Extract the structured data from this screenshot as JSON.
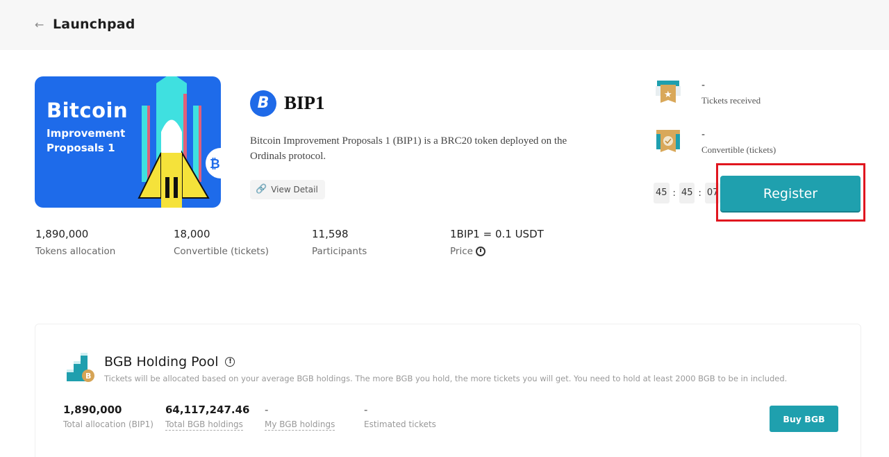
{
  "header": {
    "title": "Launchpad",
    "back_icon": "arrow-left-icon"
  },
  "banner": {
    "title": "Bitcoin",
    "subtitle_line1": "Improvement",
    "subtitle_line2": "Proposals 1",
    "colors": {
      "background": "#1e6bea"
    }
  },
  "token": {
    "logo_glyph": "B",
    "name": "BIP1",
    "description": "Bitcoin Improvement Proposals 1 (BIP1) is a BRC20 token deployed on the Ordinals protocol.",
    "view_detail_label": "View Detail"
  },
  "stats": [
    {
      "value": "1,890,000",
      "label": "Tokens allocation"
    },
    {
      "value": "18,000",
      "label": "Convertible (tickets)"
    },
    {
      "value": "11,598",
      "label": "Participants"
    },
    {
      "value": "1BIP1 = 0.1 USDT",
      "label": "Price"
    }
  ],
  "tickets": {
    "received": {
      "value": "-",
      "label": "Tickets received",
      "icon": "ticket-star-icon"
    },
    "convertible": {
      "value": "-",
      "label": "Convertible (tickets)",
      "icon": "ticket-check-icon"
    }
  },
  "countdown": {
    "hours": "45",
    "minutes": "45",
    "seconds": "07",
    "separator": ":"
  },
  "register": {
    "label": "Register",
    "accent": "#1fa0ae",
    "highlight": "#e0161f"
  },
  "pool": {
    "title": "BGB Holding Pool",
    "description": "Tickets will be allocated based on your average BGB holdings. The more BGB you hold, the more tickets you will get. You need to hold at least 2000 BGB to be in included.",
    "stats": [
      {
        "value": "1,890,000",
        "label": "Total allocation (BIP1)"
      },
      {
        "value": "64,117,247.46",
        "label": "Total BGB holdings"
      },
      {
        "value": "-",
        "label": "My BGB holdings"
      },
      {
        "value": "-",
        "label": "Estimated tickets"
      }
    ],
    "buy_label": "Buy BGB"
  }
}
